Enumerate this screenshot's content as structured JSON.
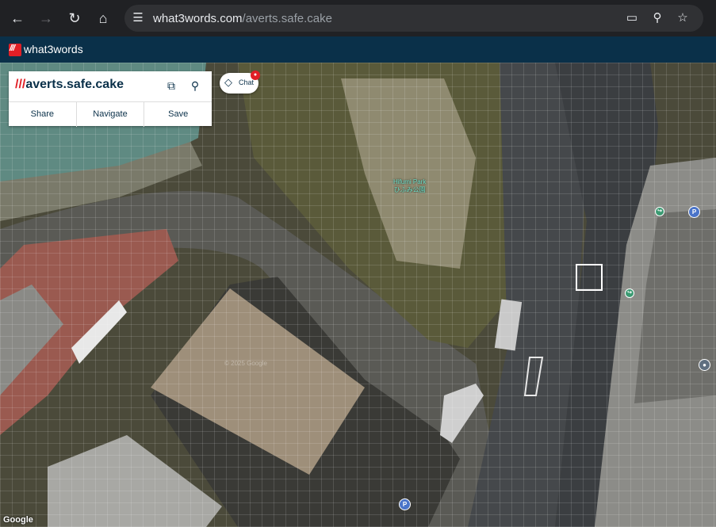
{
  "browser": {
    "url_host": "what3words.com",
    "url_path": "/averts.safe.cake",
    "back_icon": "arrow-left-icon",
    "forward_icon": "arrow-right-icon",
    "reload_icon": "reload-icon",
    "home_icon": "home-icon"
  },
  "app": {
    "brand": "what3words",
    "brand_mark": "///"
  },
  "card": {
    "slashes": "///",
    "address": "averts.safe.cake",
    "actions": [
      "Share",
      "Navigate",
      "Save"
    ]
  },
  "chat": {
    "label": "Chat"
  },
  "map": {
    "park_name": "Hifumi Park",
    "park_name_ja": "ひふみ公園",
    "copyright": "© 2025 Google",
    "google": "Google",
    "poi_labels": [
      "P",
      "P",
      "P"
    ]
  },
  "colors": {
    "brand_red": "#e11f26",
    "brand_navy": "#0a3049"
  }
}
